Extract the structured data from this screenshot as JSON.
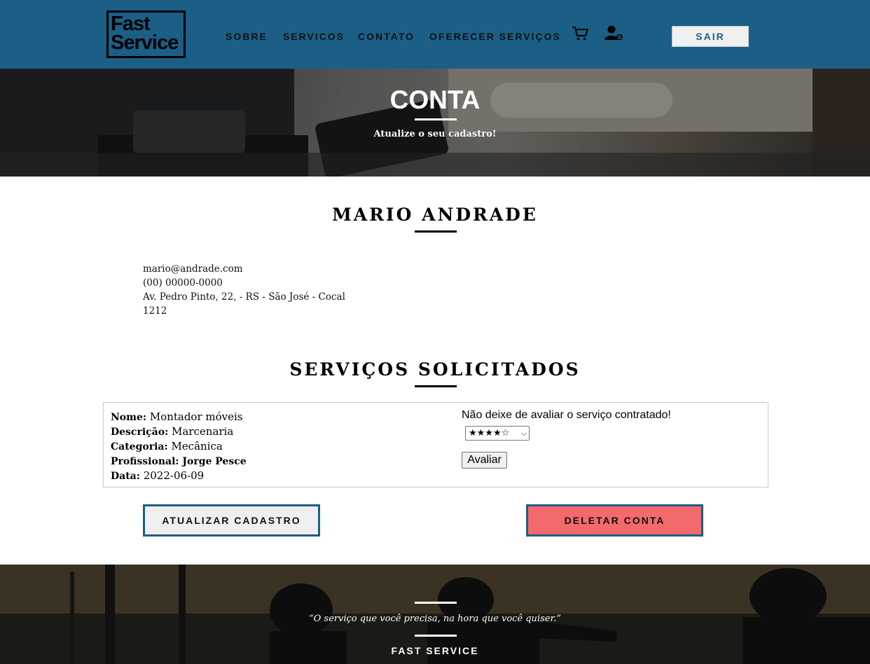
{
  "header": {
    "logo_line1": "Fast",
    "logo_line2": "Service",
    "nav": [
      "SOBRE",
      "SERVICOS",
      "CONTATO",
      "OFERECER SERVIÇOS"
    ],
    "logout_label": "SAIR",
    "icons": [
      "cart-icon",
      "user-settings-icon"
    ]
  },
  "hero": {
    "title": "CONTA",
    "subtitle": "Atualize o seu cadastro!"
  },
  "profile": {
    "name": "MARIO ANDRADE",
    "email": "mario@andrade.com",
    "phone": "(00) 00000-0000",
    "address": "Av. Pedro Pinto, 22, - RS - São José - Cocal",
    "number": "1212"
  },
  "services": {
    "title": "SERVIÇOS SOLICITADOS",
    "items": [
      {
        "name_label": "Nome:",
        "name": "Montador móveis",
        "description_label": "Descrição:",
        "description": "Marcenaria",
        "category_label": "Categoria:",
        "category": "Mecânica",
        "professional_label": "Profissional:",
        "professional": "Jorge Pesce",
        "date_label": "Data:",
        "date": "2022-06-09",
        "rating_prompt": "Não deixe de avaliar o serviço contratado!",
        "rating_selected": "★★★★☆",
        "rate_button": "Avaliar"
      }
    ]
  },
  "actions": {
    "update_label": "ATUALIZAR CADASTRO",
    "delete_label": "DELETAR CONTA"
  },
  "footer": {
    "quote": "“O serviço que você precisa, na hora que você quiser.”",
    "brand": "FAST SERVICE"
  },
  "colors": {
    "header_bg": "#1b5f86",
    "delete_bg": "#f4696b",
    "button_border": "#1b5f86"
  }
}
